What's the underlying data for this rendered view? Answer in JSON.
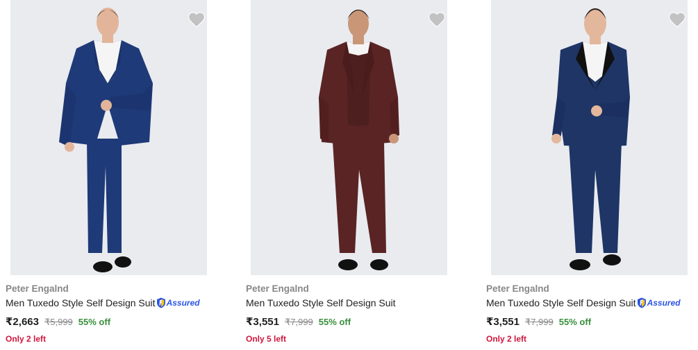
{
  "products": [
    {
      "brand": "Peter Engalnd",
      "title": "Men Tuxedo Style Self Design Suit",
      "assured": true,
      "assured_label": "Assured",
      "price": "₹2,663",
      "mrp": "₹5,999",
      "discount": "55% off",
      "stock": "Only 2 left",
      "image": "blue-suit-photo",
      "suit_color": "#1f3a78",
      "lapel_color": "#1a3268"
    },
    {
      "brand": "Peter Engalnd",
      "title": "Men Tuxedo Style Self Design Suit",
      "assured": false,
      "assured_label": "",
      "price": "₹3,551",
      "mrp": "₹7,999",
      "discount": "55% off",
      "stock": "Only 5 left",
      "image": "maroon-suit-photo",
      "suit_color": "#5a2424",
      "lapel_color": "#4a1c1c"
    },
    {
      "brand": "Peter Engalnd",
      "title": "Men Tuxedo Style Self Design Suit",
      "assured": true,
      "assured_label": "Assured",
      "price": "₹3,551",
      "mrp": "₹7,999",
      "discount": "55% off",
      "stock": "Only 2 left",
      "image": "navy-tuxedo-photo",
      "suit_color": "#1e3566",
      "lapel_color": "#111111"
    }
  ],
  "icons": {
    "wishlist": "heart-icon",
    "assured": "shield-check-icon"
  },
  "colors": {
    "brand_text": "#878787",
    "price_text": "#212121",
    "discount": "#388e3c",
    "stock": "#d0153f",
    "assured": "#2a55e5",
    "heart": "#c2c2c2",
    "image_bg": "#e9ebef"
  }
}
